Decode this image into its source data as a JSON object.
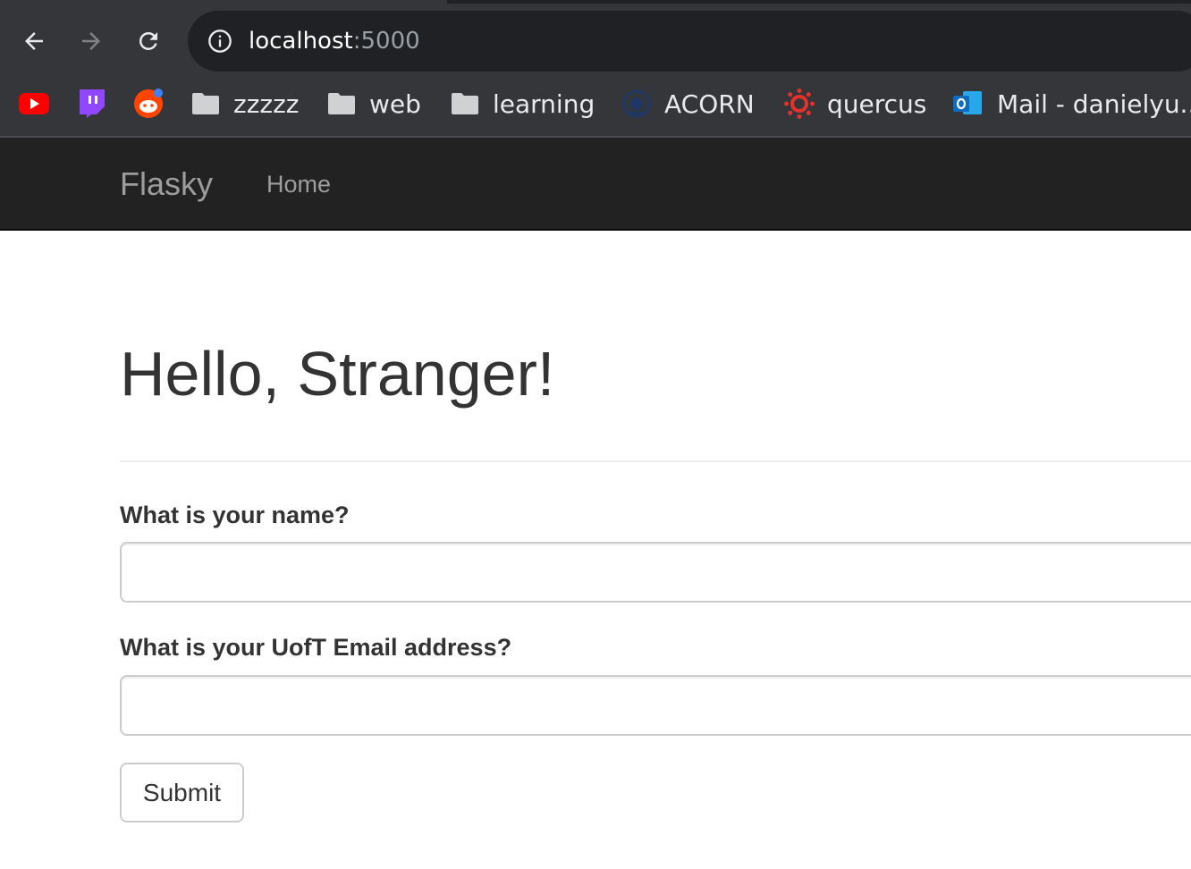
{
  "browser": {
    "url_host": "localhost",
    "url_port": ":5000",
    "bookmarks": [
      {
        "icon": "youtube-icon",
        "label": ""
      },
      {
        "icon": "twitch-icon",
        "label": ""
      },
      {
        "icon": "reddit-icon",
        "label": ""
      },
      {
        "icon": "folder-icon",
        "label": "zzzzz"
      },
      {
        "icon": "folder-icon",
        "label": "web"
      },
      {
        "icon": "folder-icon",
        "label": "learning"
      },
      {
        "icon": "acorn-icon",
        "label": "ACORN"
      },
      {
        "icon": "quercus-icon",
        "label": "quercus"
      },
      {
        "icon": "outlook-icon",
        "label": "Mail - danielyu.."
      }
    ]
  },
  "navbar": {
    "brand": "Flasky",
    "home": "Home"
  },
  "main": {
    "title": "Hello, Stranger!",
    "form": {
      "name_label": "What is your name?",
      "name_value": "",
      "email_label": "What is your UofT Email address?",
      "email_value": "",
      "submit_label": "Submit"
    }
  },
  "colors": {
    "chrome_bg": "#35363a",
    "omnibox_bg": "#202124",
    "navbar_bg": "#222222",
    "navbar_text": "#9d9d9d",
    "body_text": "#333333"
  }
}
